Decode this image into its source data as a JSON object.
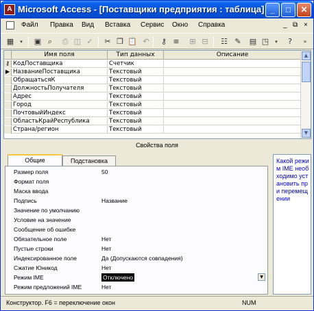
{
  "window": {
    "title": "Microsoft Access - [Поставщики предприятия : таблица]",
    "app_icon": "access-key-icon"
  },
  "menubar": {
    "items": [
      "Файл",
      "Правка",
      "Вид",
      "Вставка",
      "Сервис",
      "Окно",
      "Справка"
    ]
  },
  "grid": {
    "headers": [
      "Имя поля",
      "Тип данных",
      "Описание"
    ],
    "rows": [
      {
        "field": "КодПоставщика",
        "type": "Счетчик",
        "key": true
      },
      {
        "field": "НазваниеПоставщика",
        "type": "Текстовый",
        "current": true
      },
      {
        "field": "ОбращатьсяК",
        "type": "Текстовый"
      },
      {
        "field": "ДолжностьПолучателя",
        "type": "Текстовый"
      },
      {
        "field": "Адрес",
        "type": "Текстовый"
      },
      {
        "field": "Город",
        "type": "Текстовый"
      },
      {
        "field": "ПочтовыйИндекс",
        "type": "Текстовый"
      },
      {
        "field": "ОбластьКрайРеспублика",
        "type": "Текстовый"
      },
      {
        "field": "Страна/регион",
        "type": "Текстовый"
      }
    ]
  },
  "properties": {
    "title": "Свойства поля",
    "tabs": [
      "Общие",
      "Подстановка"
    ],
    "rows": [
      {
        "label": "Размер поля",
        "value": "50"
      },
      {
        "label": "Формат поля",
        "value": ""
      },
      {
        "label": "Маска ввода",
        "value": ""
      },
      {
        "label": "Подпись",
        "value": "Название"
      },
      {
        "label": "Значение по умолчанию",
        "value": ""
      },
      {
        "label": "Условие на значение",
        "value": ""
      },
      {
        "label": "Сообщение об ошибке",
        "value": ""
      },
      {
        "label": "Обязательное поле",
        "value": "Нет"
      },
      {
        "label": "Пустые строки",
        "value": "Нет"
      },
      {
        "label": "Индексированное поле",
        "value": "Да (Допускаются совпадения)"
      },
      {
        "label": "Сжатие Юникод",
        "value": "Нет"
      },
      {
        "label": "Режим IME",
        "value": "Отключено",
        "selected": true
      },
      {
        "label": "Режим предложений IME",
        "value": "Нет"
      }
    ],
    "help": "Какой режим IME необходимо установить при перемещении"
  },
  "status": {
    "text": "Конструктор.  F6 = переключение окон",
    "num": "NUM"
  }
}
